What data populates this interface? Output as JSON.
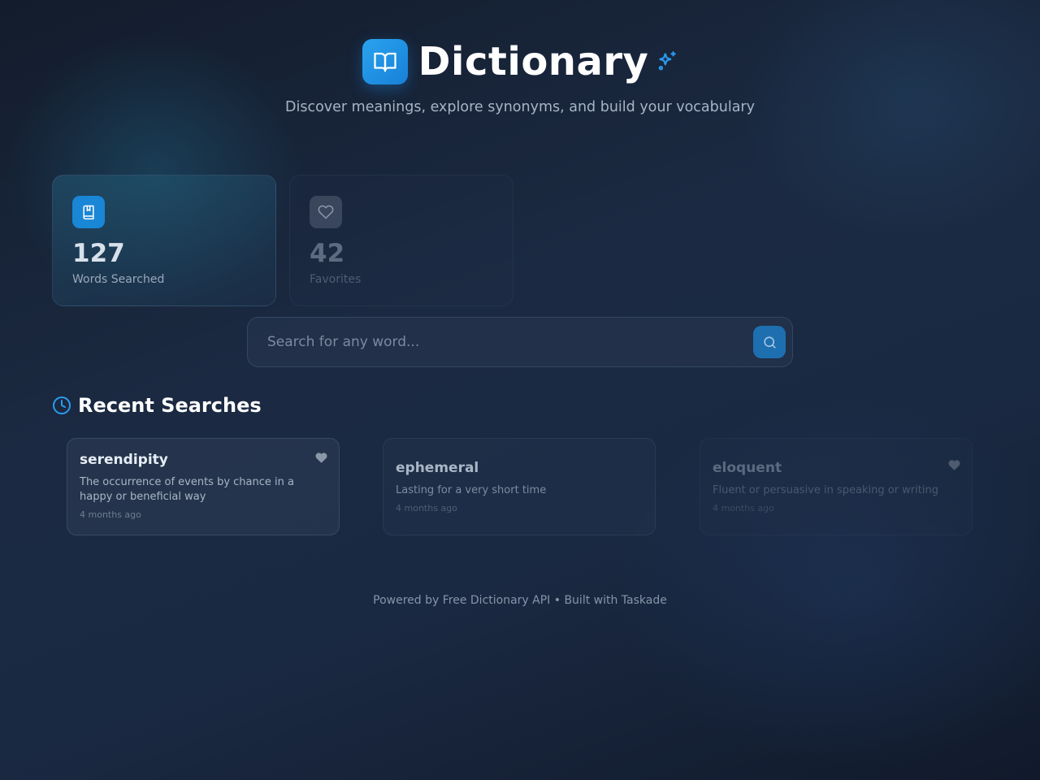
{
  "header": {
    "title": "Dictionary",
    "logo_icon": "book-open-icon",
    "sparkle_icon": "sparkles-icon",
    "subtitle": "Discover meanings, explore synonyms, and build your vocabulary",
    "accent_color": "#1f95e8"
  },
  "stats": [
    {
      "icon": "book-marked-icon",
      "value": "127",
      "label": "Words Searched"
    },
    {
      "icon": "heart-icon",
      "value": "42",
      "label": "Favorites"
    }
  ],
  "search": {
    "placeholder": "Search for any word...",
    "value": "",
    "button_icon": "search-icon"
  },
  "recent": {
    "icon": "clock-icon",
    "title": "Recent Searches",
    "items": [
      {
        "word": "serendipity",
        "definition": "The occurrence of events by chance in a happy or beneficial way",
        "time": "4 months ago",
        "favorited": true
      },
      {
        "word": "ephemeral",
        "definition": "Lasting for a very short time",
        "time": "4 months ago",
        "favorited": false
      },
      {
        "word": "eloquent",
        "definition": "Fluent or persuasive in speaking or writing",
        "time": "4 months ago",
        "favorited": true
      }
    ]
  },
  "footer": {
    "text": "Powered by Free Dictionary API • Built with Taskade"
  }
}
